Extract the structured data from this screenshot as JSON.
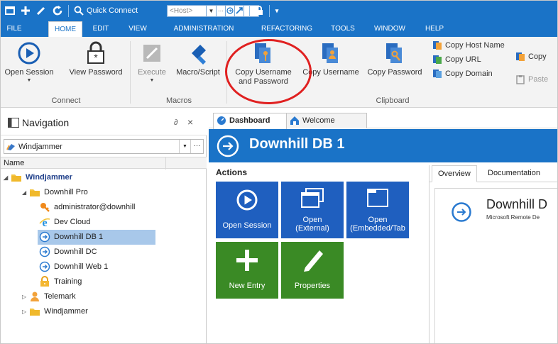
{
  "quick_access": {
    "quick_connect_label": "Quick Connect",
    "host_placeholder": "<Host>"
  },
  "menu": {
    "items": [
      "FILE",
      "HOME",
      "EDIT",
      "VIEW",
      "ADMINISTRATION",
      "REFACTORING",
      "TOOLS",
      "WINDOW",
      "HELP"
    ],
    "active": "HOME"
  },
  "ribbon": {
    "open_session": "Open Session",
    "view_password": "View Password",
    "execute": "Execute",
    "macro_script": "Macro/Script",
    "copy_username_and_password_line1": "Copy Username",
    "copy_username_and_password_line2": "and Password",
    "copy_username": "Copy Username",
    "copy_password": "Copy Password",
    "copy_host_name": "Copy Host Name",
    "copy_url": "Copy URL",
    "copy_domain": "Copy Domain",
    "copy_truncated": "Copy",
    "paste_truncated": "Paste",
    "groups": {
      "connect": "Connect",
      "macros": "Macros",
      "clipboard": "Clipboard"
    }
  },
  "navigation": {
    "title": "Navigation",
    "pin": "∂",
    "close": "×",
    "vault": "Windjammer",
    "column_name": "Name",
    "tree": [
      {
        "label": "Windjammer",
        "bold": true,
        "icon": "folder-icon",
        "expanded": true
      },
      {
        "label": "Downhill Pro",
        "icon": "folder-icon",
        "expanded": true
      },
      {
        "label": "administrator@downhill",
        "icon": "key-icon"
      },
      {
        "label": "Dev Cloud",
        "icon": "internet-explorer-icon"
      },
      {
        "label": "Downhill DB 1",
        "icon": "rdp-icon",
        "selected": true
      },
      {
        "label": "Downhill DC",
        "icon": "rdp-icon"
      },
      {
        "label": "Downhill Web 1",
        "icon": "rdp-icon"
      },
      {
        "label": "Training",
        "icon": "lock-icon"
      },
      {
        "label": "Telemark",
        "icon": "user-icon",
        "collapsed": true
      },
      {
        "label": "Windjammer",
        "icon": "folder-icon",
        "collapsed": true
      }
    ]
  },
  "main": {
    "tabs": [
      "Dashboard",
      "Welcome"
    ],
    "entry_title": "Downhill DB 1",
    "actions_title": "Actions",
    "tiles": [
      {
        "label": "Open Session"
      },
      {
        "line1": "Open",
        "line2": "(External)"
      },
      {
        "line1": "Open",
        "line2": "(Embedded/Tab"
      },
      {
        "label": "New Entry"
      },
      {
        "label": "Properties"
      }
    ],
    "right_tabs": [
      "Overview",
      "Documentation"
    ],
    "card_title": "Downhill D",
    "card_subtitle": "Microsoft Remote De"
  },
  "colors": {
    "brand_blue": "#1a73c7",
    "tile_blue": "#1f5fbf",
    "tile_green": "#3a8a25",
    "selection": "#a8c8ea",
    "highlight_ring": "#e02020"
  }
}
